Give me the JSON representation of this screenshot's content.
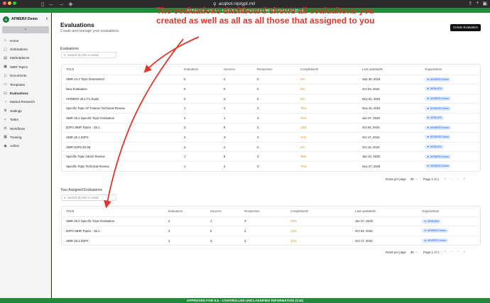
{
  "browser": {
    "url": "acqbot.niprgpt.mil"
  },
  "banner": {
    "top": "APPROVED FOR IL5 - CONTROLLED UNCLASSIFIED INFORMATION (CUI)",
    "bottom": "APPROVED FOR IL5 - CONTROLLED UNCLASSIFIED INFORMATION (CUI)"
  },
  "sidebar": {
    "org_name": "AFWERX Demo",
    "collapse_glyph": "‹",
    "items": [
      {
        "label": "Home",
        "icon": "home-icon",
        "glyph": "⌂"
      },
      {
        "label": "Solicitations",
        "icon": "document-icon",
        "glyph": "▢"
      },
      {
        "label": "Marketplaces",
        "icon": "store-icon",
        "glyph": "▤"
      },
      {
        "label": "SBIR Topics",
        "icon": "topics-icon",
        "glyph": "▣"
      },
      {
        "label": "Documents",
        "icon": "documents-icon",
        "glyph": "▯"
      },
      {
        "label": "Templates",
        "icon": "template-icon",
        "glyph": "▭"
      },
      {
        "label": "Evaluations",
        "icon": "evaluations-icon",
        "glyph": "☑"
      },
      {
        "label": "Market Research",
        "icon": "research-icon",
        "glyph": "◔"
      },
      {
        "label": "Settings",
        "icon": "gear-icon",
        "glyph": "⚙"
      },
      {
        "label": "Tasks",
        "icon": "tasks-icon",
        "glyph": "✓"
      },
      {
        "label": "Workflows",
        "icon": "workflow-icon",
        "glyph": "⇄"
      },
      {
        "label": "Training",
        "icon": "training-icon",
        "glyph": "▦"
      },
      {
        "label": "Admin",
        "icon": "admin-icon",
        "glyph": "◉"
      }
    ]
  },
  "page": {
    "title": "Evaluations",
    "subtitle": "Create and manage your evaluations.",
    "create_button": "Create Evaluation"
  },
  "annotation": "The evaluations dashboard shows all evaluaitons you created as well as all as all those that assigned to you",
  "evaluations": {
    "section_label": "Evaluations",
    "search_placeholder": "Search by title or email",
    "columns": [
      "Title",
      "Evaluators",
      "Sources",
      "Responses",
      "Completion",
      "Last Updated",
      "Organization"
    ],
    "rows": [
      {
        "title": "SBIR 24.2 Topic Downselect",
        "evaluators": "0",
        "sources": "4",
        "responses": "0",
        "completion": "0%",
        "updated": "Sep 30, 2024",
        "org": "AFWERX Demo"
      },
      {
        "title": "New Evaluation",
        "evaluators": "0",
        "sources": "0",
        "responses": "0",
        "completion": "0%",
        "updated": "Oct 03, 2024",
        "org": "AFWLIRX"
      },
      {
        "title": "AFWERX 25.1 P1 Evals",
        "evaluators": "0",
        "sources": "3",
        "responses": "0",
        "completion": "0%",
        "updated": "Nov 01, 2024",
        "org": "AFWERX Demo"
      },
      {
        "title": "Specific Topic AF Futures Technical Review",
        "evaluators": "1",
        "sources": "4",
        "responses": "3",
        "completion": "75%",
        "updated": "Nov 15, 2024",
        "org": "AFWERX Demo"
      },
      {
        "title": "SBIR 25.2 Specific Topic Evaluation",
        "evaluators": "4",
        "sources": "1",
        "responses": "3",
        "completion": "75%",
        "updated": "Jan 07, 2025",
        "org": "AFWLIRX"
      },
      {
        "title": "D2P2 SBIR Topics - 25.1",
        "evaluators": "3",
        "sources": "5",
        "responses": "2",
        "completion": "13%",
        "updated": "Oct 04, 2024",
        "org": "AFWERX Demo"
      },
      {
        "title": "SBIR 25.1 D2P2",
        "evaluators": "4",
        "sources": "3",
        "responses": "2",
        "completion": "17%",
        "updated": "Oct 17, 2024",
        "org": "AFWERX Demo"
      },
      {
        "title": "SBIR D2P2 25.2B",
        "evaluators": "2",
        "sources": "4",
        "responses": "0",
        "completion": "0%",
        "updated": "Oct 16, 2024",
        "org": "AFWLIRX"
      },
      {
        "title": "Specific Topic Admin Review",
        "evaluators": "1",
        "sources": "8",
        "responses": "3",
        "completion": "38%",
        "updated": "Jan 10, 2025",
        "org": "AFWERX Demo"
      },
      {
        "title": "Specific Topic Technical Review",
        "evaluators": "1",
        "sources": "4",
        "responses": "3",
        "completion": "75%",
        "updated": "Nov 27, 2024",
        "org": "AFWERX Demo"
      }
    ],
    "pager": {
      "rows_label": "Rows per page",
      "rows_value": "30",
      "page_label": "Page 1 of 1"
    }
  },
  "assigned": {
    "section_label": "Your Assigned Evaluations",
    "search_placeholder": "Search by title or email",
    "columns": [
      "Title",
      "Evaluators",
      "Sources",
      "Responses",
      "Completion",
      "Last Updated",
      "Organization"
    ],
    "rows": [
      {
        "title": "SBIR 25.2 Specific Topic Evaluation",
        "evaluators": "4",
        "sources": "1",
        "responses": "3",
        "completion": "75%",
        "updated": "Jan 07, 2025",
        "org": "AFWLIRX"
      },
      {
        "title": "D2P2 SBIR Topics - 25.1",
        "evaluators": "3",
        "sources": "5",
        "responses": "2",
        "completion": "13%",
        "updated": "Oct 04, 2024",
        "org": "AFWERX Demo"
      },
      {
        "title": "SBIR 25.1 D2P2",
        "evaluators": "4",
        "sources": "3",
        "responses": "2",
        "completion": "17%",
        "updated": "Oct 17, 2024",
        "org": "AFWERX Demo"
      }
    ],
    "pager": {
      "rows_label": "Rows per page",
      "rows_value": "30",
      "page_label": "Page 1 of 1"
    }
  },
  "colors": {
    "accent": "#e0352b",
    "completion": "#d68a18",
    "badge_bg": "#dbeafe",
    "badge_fg": "#1d4ed8",
    "banner": "#1e8a3a"
  }
}
